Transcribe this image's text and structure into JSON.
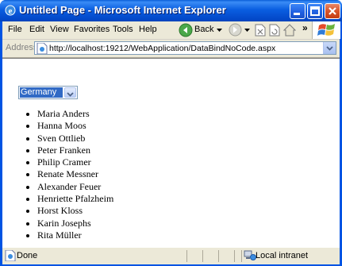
{
  "window": {
    "title": "Untitled Page - Microsoft Internet Explorer"
  },
  "menu": {
    "items": [
      "File",
      "Edit",
      "View",
      "Favorites",
      "Tools",
      "Help"
    ]
  },
  "toolbar": {
    "back_label": "Back",
    "icons": [
      "back-icon",
      "forward-icon",
      "stop-icon",
      "refresh-icon",
      "home-icon",
      "windows-logo-icon"
    ]
  },
  "address": {
    "label": "Address",
    "url": "http://localhost:19212/WebApplication/DataBindNoCode.aspx"
  },
  "page": {
    "country_selected": "Germany",
    "names": [
      "Maria Anders",
      "Hanna Moos",
      "Sven Ottlieb",
      "Peter Franken",
      "Philip Cramer",
      "Renate Messner",
      "Alexander Feuer",
      "Henriette Pfalzheim",
      "Horst Kloss",
      "Karin Josephs",
      "Rita Müller"
    ]
  },
  "status": {
    "left_text": "Done",
    "zone_text": "Local intranet"
  },
  "colors": {
    "titlebar": "#0054e3",
    "selection": "#316ac5",
    "chrome": "#ece9d8"
  }
}
